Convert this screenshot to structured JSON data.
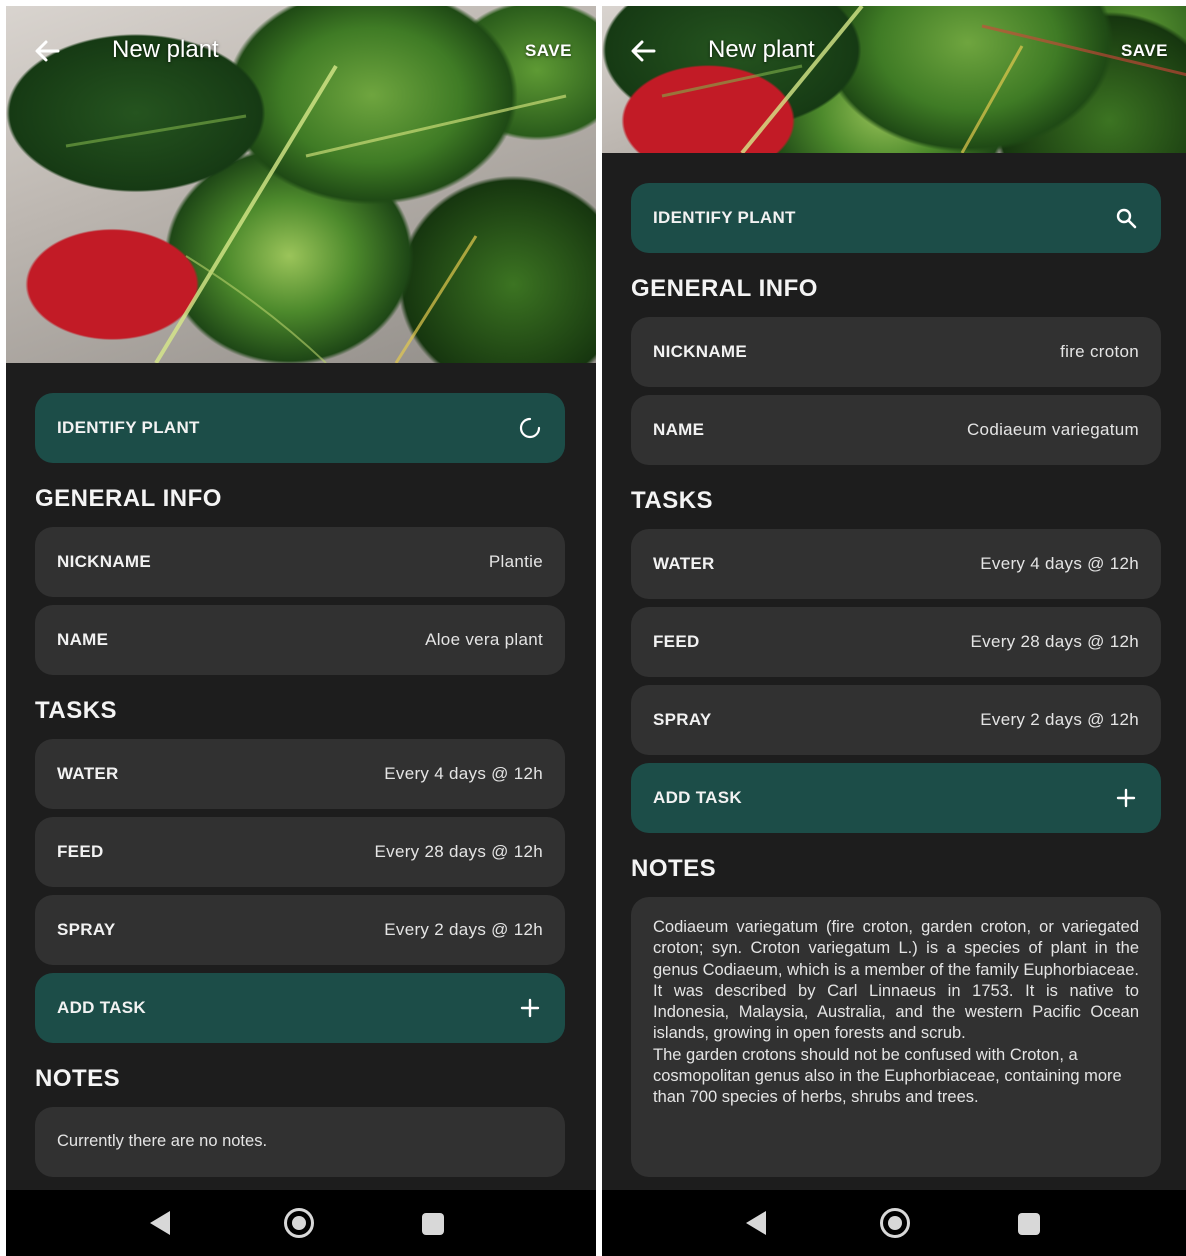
{
  "screens": [
    {
      "app_bar": {
        "title": "New plant",
        "save_label": "SAVE"
      },
      "identify": {
        "label": "IDENTIFY PLANT",
        "icon": "loading-spinner-icon"
      },
      "general": {
        "title": "GENERAL INFO",
        "nickname_label": "NICKNAME",
        "nickname_value": "Plantie",
        "name_label": "NAME",
        "name_value": "Aloe vera plant"
      },
      "tasks": {
        "title": "TASKS",
        "items": [
          {
            "label": "WATER",
            "value": "Every 4 days @ 12h"
          },
          {
            "label": "FEED",
            "value": "Every 28 days @ 12h"
          },
          {
            "label": "SPRAY",
            "value": "Every 2 days @ 12h"
          }
        ],
        "add_label": "ADD TASK"
      },
      "notes": {
        "title": "NOTES",
        "paragraphs": [
          "Currently there are no notes."
        ]
      }
    },
    {
      "app_bar": {
        "title": "New plant",
        "save_label": "SAVE"
      },
      "identify": {
        "label": "IDENTIFY PLANT",
        "icon": "search-icon"
      },
      "general": {
        "title": "GENERAL INFO",
        "nickname_label": "NICKNAME",
        "nickname_value": "fire croton",
        "name_label": "NAME",
        "name_value": "Codiaeum variegatum"
      },
      "tasks": {
        "title": "TASKS",
        "items": [
          {
            "label": "WATER",
            "value": "Every 4 days @ 12h"
          },
          {
            "label": "FEED",
            "value": "Every 28 days @ 12h"
          },
          {
            "label": "SPRAY",
            "value": "Every 2 days @ 12h"
          }
        ],
        "add_label": "ADD TASK"
      },
      "notes": {
        "title": "NOTES",
        "paragraphs": [
          "Codiaeum variegatum (fire croton, garden croton, or variegated croton; syn. Croton variegatum L.) is a species of plant in the genus Codiaeum, which is a member of the family Euphorbiaceae. It was described by Carl Linnaeus in 1753. It is native to Indonesia, Malaysia, Australia, and the western Pacific Ocean islands, growing in open forests and scrub.",
          "The garden crotons should not be confused with Croton, a cosmopolitan genus also in the Euphorbiaceae, containing more than 700 species of herbs, shrubs and trees."
        ]
      }
    }
  ],
  "colors": {
    "background": "#1d1d1d",
    "card": "#313131",
    "accent": "#1c4d48",
    "text": "#f2f2f2",
    "navbar": "#000000"
  }
}
